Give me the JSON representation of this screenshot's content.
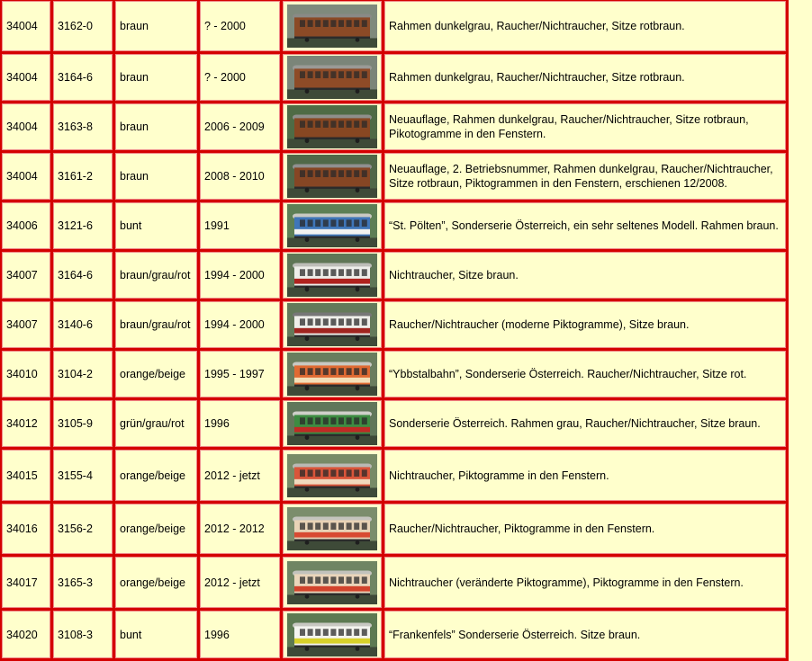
{
  "rows": [
    {
      "nr": "34004",
      "art": "3162-0",
      "color": "braun",
      "years": "? - 2000",
      "desc": "Rahmen dunkelgrau, Raucher/Nichtraucher, Sitze rotbraun.",
      "wagon": {
        "body": "#8b4a26",
        "roof": "#8a8a86",
        "stripe": null,
        "bg": "#7f8a7c"
      }
    },
    {
      "nr": "34004",
      "art": "3164-6",
      "color": "braun",
      "years": "? - 2000",
      "desc": "Rahmen dunkelgrau, Raucher/Nichtraucher, Sitze rotbraun.",
      "wagon": {
        "body": "#8e4b27",
        "roof": "#9a9a96",
        "stripe": null,
        "bg": "#7b8579"
      }
    },
    {
      "nr": "34004",
      "art": "3163-8",
      "color": "braun",
      "years": "2006 - 2009",
      "desc": "Neuauflage, Rahmen dunkelgrau, Raucher/Nichtraucher, Sitze rotbraun, Pikotogramme in den Fenstern.",
      "wagon": {
        "body": "#874722",
        "roof": "#8f8f8b",
        "stripe": null,
        "bg": "#4f6b45"
      }
    },
    {
      "nr": "34004",
      "art": "3161-2",
      "color": "braun",
      "years": "2008 - 2010",
      "desc": "Neuauflage, 2. Betriebsnummer, Rahmen dunkelgrau, Raucher/Nichtraucher, Sitze rotbraun, Piktogrammen in den Fenstern, erschienen 12/2008.",
      "wagon": {
        "body": "#864624",
        "roof": "#909090",
        "stripe": null,
        "bg": "#506848"
      }
    },
    {
      "nr": "34006",
      "art": "3121-6",
      "color": "bunt",
      "years": "1991",
      "desc": "“St. Pölten”, Sonderserie Österreich, ein sehr seltenes Modell. Rahmen braun.",
      "wagon": {
        "body": "#3f76b8",
        "roof": "#c9c9c2",
        "stripe": "#f2f2f0",
        "bg": "#5d7f55"
      }
    },
    {
      "nr": "34007",
      "art": "3164-6",
      "color": "braun/grau/rot",
      "years": "1994 - 2000",
      "desc": "Nichtraucher, Sitze braun.",
      "wagon": {
        "body": "#eeeeea",
        "roof": "#bdbdb8",
        "stripe": "#b0221e",
        "bg": "#5f7656"
      }
    },
    {
      "nr": "34007",
      "art": "3140-6",
      "color": "braun/grau/rot",
      "years": "1994 - 2000",
      "desc": "Raucher/Nichtraucher (moderne Piktogramme), Sitze braun.",
      "wagon": {
        "body": "#efefea",
        "roof": "#777777",
        "stripe": "#a0241f",
        "bg": "#647a5a"
      }
    },
    {
      "nr": "34010",
      "art": "3104-2",
      "color": "orange/beige",
      "years": "1995 - 1997",
      "desc": "“Ybbstalbahn”, Sonderserie Österreich. Raucher/Nichtraucher, Sitze rot.",
      "wagon": {
        "body": "#e06a33",
        "roof": "#c8c8c2",
        "stripe": "#f3dfb8",
        "bg": "#6a7d5e"
      }
    },
    {
      "nr": "34012",
      "art": "3105-9",
      "color": "grün/grau/rot",
      "years": "1996",
      "desc": "Sonderserie Österreich. Rahmen grau, Raucher/Nichtraucher, Sitze braun.",
      "wagon": {
        "body": "#3d8c42",
        "roof": "#cfcfca",
        "stripe": "#c02a24",
        "bg": "#61775a"
      }
    },
    {
      "nr": "34015",
      "art": "3155-4",
      "color": "orange/beige",
      "years": "2012 - jetzt",
      "desc": "Nichtraucher, Piktogramme in den Fenstern.",
      "wagon": {
        "body": "#d9553a",
        "roof": "#b9b9b4",
        "stripe": "#f0d9bd",
        "bg": "#778a66"
      }
    },
    {
      "nr": "34016",
      "art": "3156-2",
      "color": "orange/beige",
      "years": "2012 - 2012",
      "desc": "Raucher/Nichtraucher, Piktogramme in den Fenstern.",
      "wagon": {
        "body": "#e9d3b6",
        "roof": "#c4c4be",
        "stripe": "#d84a32",
        "bg": "#7b8d6c"
      }
    },
    {
      "nr": "34017",
      "art": "3165-3",
      "color": "orange/beige",
      "years": "2012 - jetzt",
      "desc": "Nichtraucher (veränderte Piktogramme), Piktogramme in den Fenstern.",
      "wagon": {
        "body": "#ead5ba",
        "roof": "#c2c2bc",
        "stripe": "#d2432c",
        "bg": "#6f8563"
      }
    },
    {
      "nr": "34020",
      "art": "3108-3",
      "color": "bunt",
      "years": "1996",
      "desc": "“Frankenfels” Sonderserie Österreich. Sitze braun.",
      "wagon": {
        "body": "#f4f4ef",
        "roof": "#c8c8c2",
        "stripe": "#d7d02a",
        "bg": "#5d7a52"
      }
    }
  ]
}
